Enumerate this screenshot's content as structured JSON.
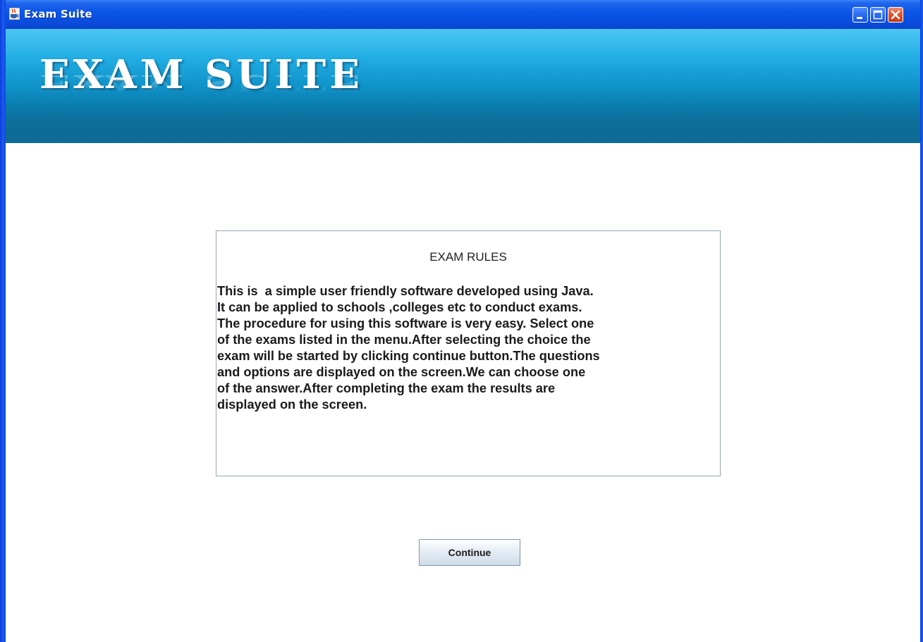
{
  "window": {
    "title": "Exam Suite",
    "icon": "java-cup-icon",
    "controls": [
      "minimize-icon",
      "maximize-icon",
      "close-icon"
    ]
  },
  "banner": {
    "title": "EXAM SUITE"
  },
  "rules": {
    "heading": "EXAM RULES",
    "body": "This is  a simple user friendly software developed using Java.\nIt can be applied to schools ,colleges etc to conduct exams.\nThe procedure for using this software is very easy. Select one\nof the exams listed in the menu.After selecting the choice the\nexam will be started by clicking continue button.The questions\nand options are displayed on the screen.We can choose one\nof the answer.After completing the exam the results are\ndisplayed on the screen."
  },
  "actions": {
    "continue_label": "Continue"
  },
  "colors": {
    "titlebar": "#0a55e6",
    "banner": "#0f93c9",
    "close_button": "#e0532f",
    "panel_border": "#9aa7b3"
  }
}
